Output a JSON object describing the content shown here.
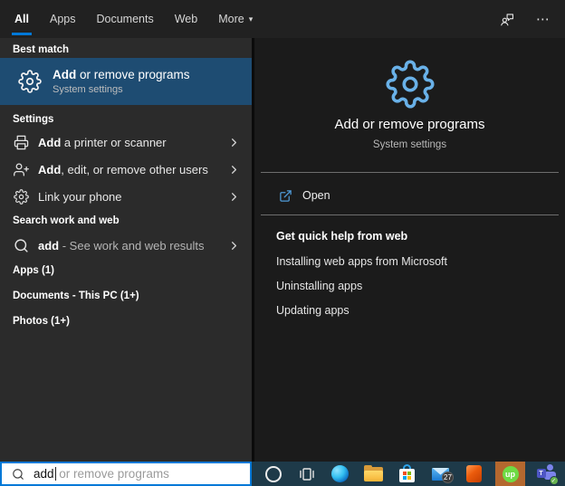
{
  "topbar": {
    "tabs": [
      {
        "label": "All",
        "active": true
      },
      {
        "label": "Apps",
        "active": false
      },
      {
        "label": "Documents",
        "active": false
      },
      {
        "label": "Web",
        "active": false
      },
      {
        "label": "More",
        "active": false
      }
    ],
    "more_caret": "▾",
    "ellipsis_glyph": "⋯",
    "icons": [
      "feedback-icon",
      "more-options-icon"
    ]
  },
  "left": {
    "best_match_header": "Best match",
    "best_match": {
      "bold": "Add",
      "rest": " or remove programs",
      "subtitle": "System settings",
      "icon": "gear-icon"
    },
    "settings_header": "Settings",
    "settings_items": [
      {
        "bold": "Add",
        "rest": " a printer or scanner",
        "icon": "printer-icon"
      },
      {
        "bold": "Add",
        "rest": ", edit, or remove other users",
        "icon": "add-user-icon"
      },
      {
        "bold": "",
        "rest": "Link your phone",
        "icon": "gear-icon"
      }
    ],
    "search_web_header": "Search work and web",
    "search_web_item": {
      "bold": "add",
      "rest": " - See work and web results",
      "icon": "search-icon"
    },
    "categories": [
      "Apps (1)",
      "Documents - This PC (1+)",
      "Photos (1+)"
    ]
  },
  "right": {
    "hero_icon": "gear-icon",
    "title": "Add or remove programs",
    "subtitle": "System settings",
    "open_label": "Open",
    "open_icon": "open-external-icon",
    "help_header": "Get quick help from web",
    "help_links": [
      "Installing web apps from Microsoft",
      "Uninstalling apps",
      "Updating apps"
    ]
  },
  "search_box": {
    "typed": "add",
    "suggestion": " or remove programs",
    "icon": "search-icon"
  },
  "taskbar": {
    "icons": [
      "cortana-icon",
      "task-view-icon",
      "edge-icon",
      "file-explorer-icon",
      "store-icon",
      "mail-icon",
      "office-icon",
      "upwork-icon",
      "teams-icon"
    ],
    "mail_badge": "27",
    "upwork_label": "up",
    "teams_letter": "T",
    "check_glyph": "✓"
  },
  "colors": {
    "accent": "#0078d7",
    "best_match_highlight": "#1e4c72",
    "hero_gear_blue": "#69b1e8",
    "topbar_bg": "#212121",
    "left_panel_bg": "#2b2b2b",
    "right_panel_bg": "#1b1b1b",
    "taskbar_bg": "#1e3a49",
    "upwork_green": "#6fda44",
    "upwork_tile": "#b4682f",
    "teams_purple": "#7b83eb",
    "office_orange": "#eb5b0c",
    "folder_yellow": "#f5b335"
  }
}
